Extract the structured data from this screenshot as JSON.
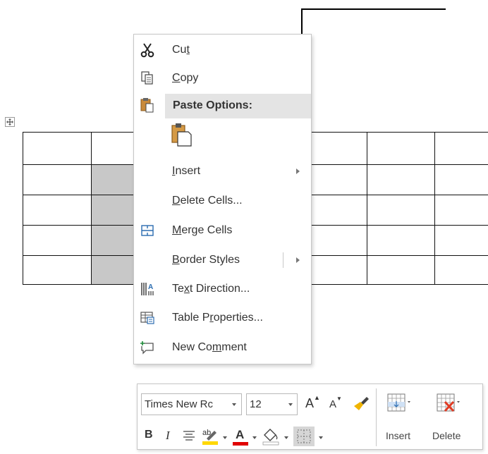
{
  "context_menu": {
    "cut": {
      "pre": "Cu",
      "key": "t",
      "post": ""
    },
    "copy": {
      "pre": "",
      "key": "C",
      "post": "opy"
    },
    "paste_options": "Paste Options:",
    "insert": {
      "pre": "",
      "key": "I",
      "post": "nsert"
    },
    "delete_cells": {
      "pre": "",
      "key": "D",
      "post": "elete Cells..."
    },
    "merge_cells": {
      "pre": "",
      "key": "M",
      "post": "erge Cells"
    },
    "border_styles": {
      "pre": "",
      "key": "B",
      "post": "order Styles"
    },
    "text_direction": {
      "pre": "Te",
      "key": "x",
      "post": "t Direction..."
    },
    "table_properties": {
      "pre": "Table P",
      "key": "r",
      "post": "operties..."
    },
    "new_comment": {
      "pre": "New Co",
      "key": "m",
      "post": "ment"
    }
  },
  "mini_toolbar": {
    "font_name": "Times New Rc",
    "font_size": "12",
    "bold": "B",
    "italic": "I",
    "font_color_letter": "A",
    "grow_font": "A",
    "shrink_font": "A",
    "insert_label": "Insert",
    "delete_label": "Delete"
  },
  "colors": {
    "highlight": "#ffd800",
    "font_color": "#e00000",
    "selected_cells": "#c8c8c8",
    "paste_header": "#e4e4e4"
  },
  "icons": [
    "scissors-icon",
    "copy-icon",
    "clipboard-icon",
    "paste-keep-formatting-icon",
    "merge-cells-icon",
    "text-direction-icon",
    "table-properties-icon",
    "new-comment-icon",
    "table-move-handle-icon"
  ]
}
